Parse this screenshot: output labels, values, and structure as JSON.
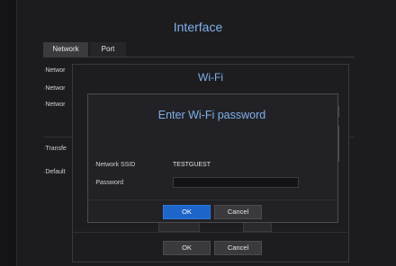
{
  "interface": {
    "title": "Interface",
    "tabs": [
      {
        "label": "Network"
      },
      {
        "label": "Port"
      }
    ],
    "rows": [
      {
        "label": "Networ"
      },
      {
        "label": "Networ"
      },
      {
        "label": "Networ"
      },
      {
        "label": "Transfe"
      },
      {
        "label": "Default"
      }
    ],
    "ok_label": "OK",
    "cancel_label": "Cancel"
  },
  "wifi": {
    "title": "Wi-Fi"
  },
  "password_dialog": {
    "title": "Enter Wi-Fi password",
    "ssid_label": "Network SSID",
    "ssid_value": "TESTGUEST",
    "password_label": "Password",
    "password_value": "",
    "ok_label": "OK",
    "cancel_label": "Cancel"
  },
  "colors": {
    "accent_title": "#7fb0ea",
    "primary_button": "#1d65c9",
    "background": "#141416"
  }
}
